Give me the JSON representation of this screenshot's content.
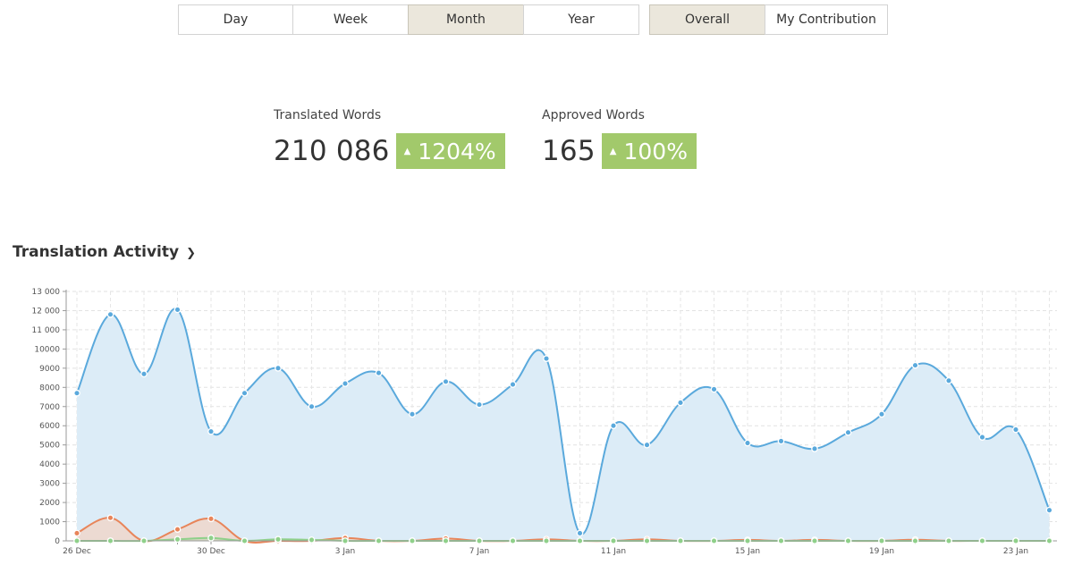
{
  "period_tabs": [
    {
      "label": "Day",
      "active": false
    },
    {
      "label": "Week",
      "active": false
    },
    {
      "label": "Month",
      "active": true
    },
    {
      "label": "Year",
      "active": false
    }
  ],
  "scope_tabs": [
    {
      "label": "Overall",
      "active": true
    },
    {
      "label": "My Contribution",
      "active": false
    }
  ],
  "stats": {
    "translated": {
      "label": "Translated Words",
      "value": "210 086",
      "change": "1204%"
    },
    "approved": {
      "label": "Approved Words",
      "value": "165",
      "change": "100%"
    }
  },
  "section": {
    "title": "Translation Activity"
  },
  "colors": {
    "translated": "#5aa9dc",
    "translated_fill": "#dcecf7",
    "approved": "#e8855a",
    "approved_fill": "#eed7cb",
    "other": "#8fd08a",
    "badge": "#a2c96b",
    "active_tab": "#ebe7dc"
  },
  "chart_data": {
    "type": "area",
    "x": [
      "26 Dec",
      "27 Dec",
      "28 Dec",
      "29 Dec",
      "30 Dec",
      "31 Dec",
      "1 Jan",
      "2 Jan",
      "3 Jan",
      "4 Jan",
      "5 Jan",
      "6 Jan",
      "7 Jan",
      "8 Jan",
      "9 Jan",
      "10 Jan",
      "11 Jan",
      "12 Jan",
      "13 Jan",
      "14 Jan",
      "15 Jan",
      "16 Jan",
      "17 Jan",
      "18 Jan",
      "19 Jan",
      "20 Jan",
      "21 Jan",
      "22 Jan",
      "23 Jan",
      "24 Jan"
    ],
    "x_tick_labels": [
      "26 Dec",
      "30 Dec",
      "3 Jan",
      "7 Jan",
      "11 Jan",
      "15 Jan",
      "19 Jan",
      "23 Jan"
    ],
    "y_tick_labels": [
      "0",
      "1000",
      "2000",
      "3000",
      "4000",
      "5000",
      "6000",
      "7000",
      "8000",
      "9000",
      "10000",
      "11 000",
      "12 000",
      "13 000"
    ],
    "ylim": [
      0,
      13000
    ],
    "grid": true,
    "series": [
      {
        "values": [
          7700,
          11800,
          8700,
          12050,
          5700,
          7700,
          9000,
          7000,
          8200,
          8750,
          6600,
          8300,
          7100,
          8150,
          9500,
          400,
          6000,
          5000,
          7200,
          7900,
          5100,
          5200,
          4800,
          5650,
          6600,
          9150,
          8350,
          5400,
          5800,
          1600
        ]
      },
      {
        "values": [
          400,
          1200,
          0,
          600,
          1150,
          0,
          0,
          0,
          150,
          0,
          0,
          120,
          0,
          0,
          80,
          0,
          0,
          80,
          0,
          0,
          50,
          0,
          50,
          0,
          0,
          60,
          0,
          0,
          0,
          0
        ]
      },
      {
        "values": [
          0,
          0,
          0,
          80,
          150,
          0,
          80,
          50,
          0,
          0,
          0,
          0,
          0,
          0,
          0,
          0,
          0,
          0,
          0,
          0,
          0,
          0,
          0,
          0,
          0,
          0,
          0,
          0,
          0,
          0
        ]
      }
    ]
  }
}
